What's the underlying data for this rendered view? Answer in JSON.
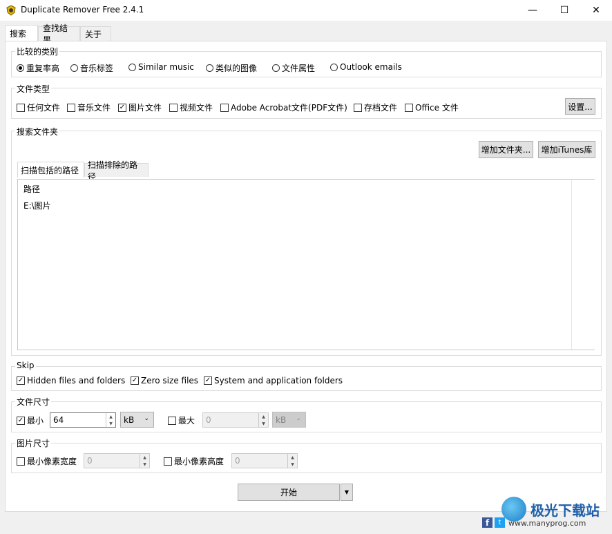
{
  "window": {
    "title": "Duplicate Remover Free 2.4.1",
    "minimize": "—",
    "maximize": "☐",
    "close": "✕"
  },
  "tabs": [
    "搜索",
    "查找结果",
    "关于"
  ],
  "compare": {
    "legend": "比较的类别",
    "options": [
      "重复率高",
      "音乐标签",
      "Similar music",
      "类似的图像",
      "文件属性",
      "Outlook emails"
    ],
    "selected": 0
  },
  "filetype": {
    "legend": "文件类型",
    "options": [
      {
        "label": "任何文件",
        "checked": false
      },
      {
        "label": "音乐文件",
        "checked": false
      },
      {
        "label": "图片文件",
        "checked": true
      },
      {
        "label": "视频文件",
        "checked": false
      },
      {
        "label": "Adobe Acrobat文件(PDF文件)",
        "checked": false
      },
      {
        "label": "存档文件",
        "checked": false
      },
      {
        "label": "Office 文件",
        "checked": false
      }
    ],
    "settings_button": "设置..."
  },
  "folders": {
    "legend": "搜索文件夹",
    "add_folder_button": "增加文件夹...",
    "add_itunes_button": "增加iTunes库",
    "tabs": [
      "扫描包括的路径",
      "扫描排除的路径"
    ],
    "column_header": "路径",
    "rows": [
      "E:\\图片"
    ]
  },
  "skip": {
    "legend": "Skip",
    "options": [
      {
        "label": "Hidden files and folders",
        "checked": true
      },
      {
        "label": "Zero size files",
        "checked": true
      },
      {
        "label": "System and application folders",
        "checked": true
      }
    ]
  },
  "filesize": {
    "legend": "文件尺寸",
    "min_label": "最小",
    "min_checked": true,
    "min_value": "64",
    "min_unit": "kB",
    "max_label": "最大",
    "max_checked": false,
    "max_value": "0",
    "max_unit": "kB"
  },
  "imagesize": {
    "legend": "图片尺寸",
    "min_width_label": "最小像素宽度",
    "min_width_value": "0",
    "min_height_label": "最小像素高度",
    "min_height_value": "0"
  },
  "start_button": "开始",
  "watermark": {
    "brand": "极光下载站",
    "url": "www.manyprog.com"
  },
  "colors": {
    "titlebar": "#ffffff",
    "window": "#f0f0f0",
    "button": "#e1e1e1",
    "check": "#000000"
  }
}
